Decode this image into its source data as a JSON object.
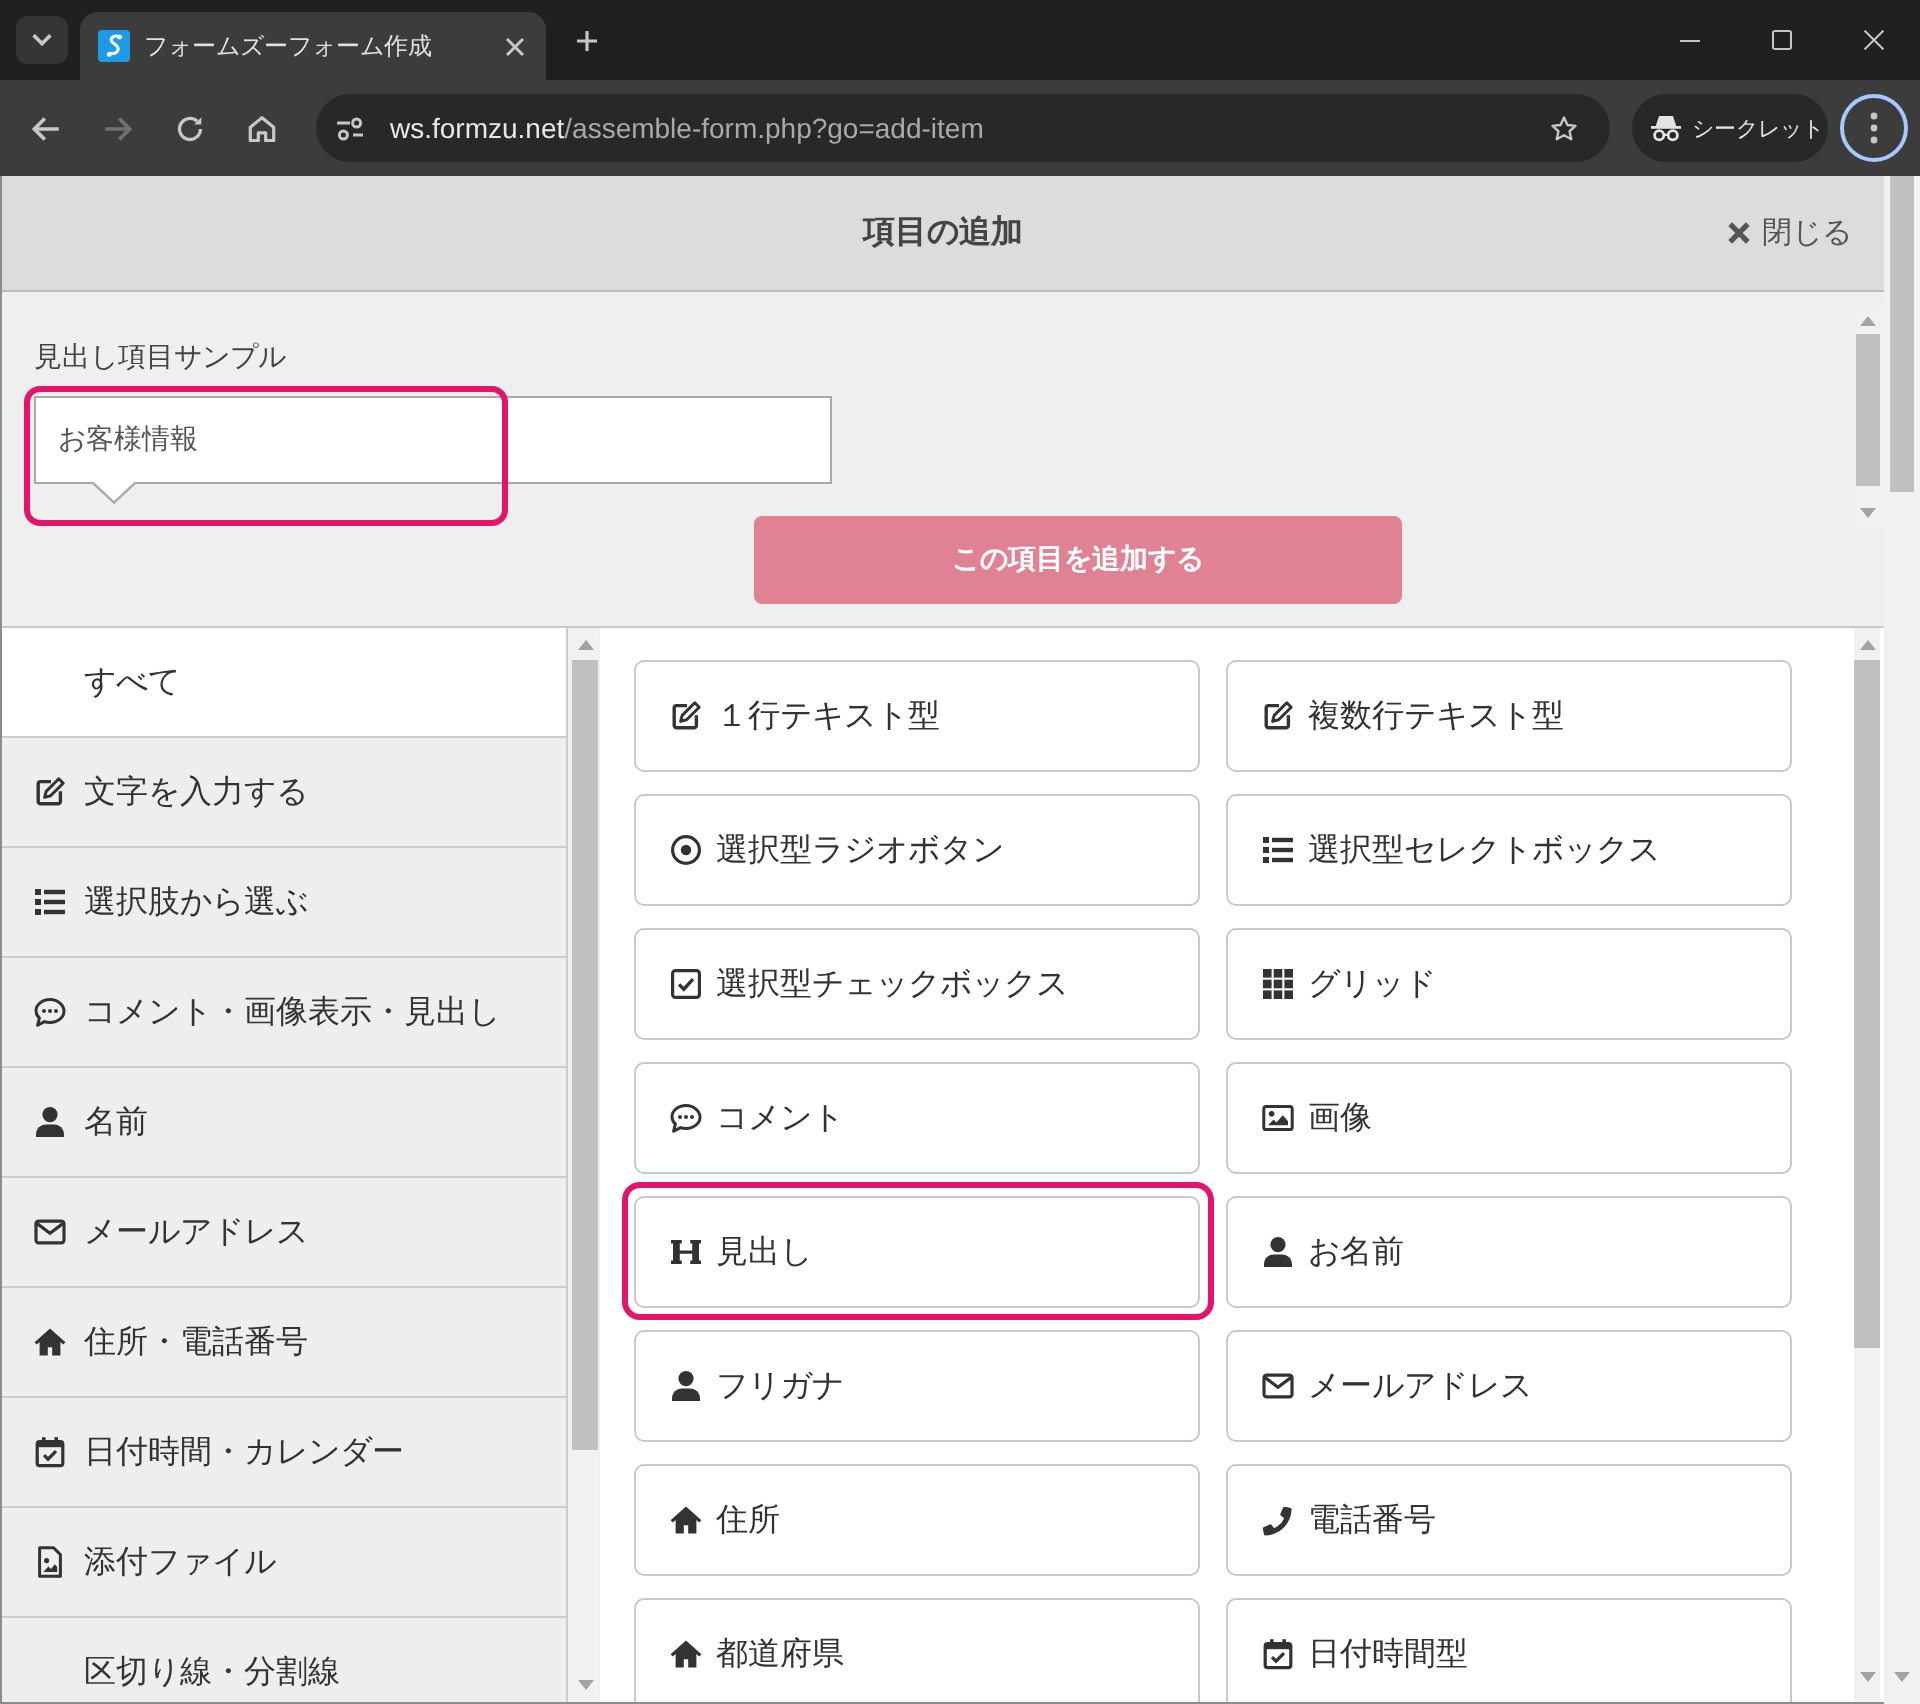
{
  "browser": {
    "tab": {
      "title": "フォームズーフォーム作成"
    },
    "forward_disabled": true,
    "address": {
      "host": "ws.formzu.net",
      "path": "/assemble-form.php?go=add-item"
    },
    "profile": {
      "label": "シークレット"
    }
  },
  "dialog": {
    "title": "項目の追加",
    "close_label": "閉じる"
  },
  "sample": {
    "label": "見出し項目サンプル",
    "value": "お客様情報",
    "highlighted": true,
    "add_button": "この項目を追加する"
  },
  "categories": [
    {
      "label": "すべて",
      "kind": "all",
      "selected": true
    },
    {
      "label": "文字を入力する",
      "kind": "text",
      "selected": false
    },
    {
      "label": "選択肢から選ぶ",
      "kind": "choice",
      "selected": false
    },
    {
      "label": "コメント・画像表示・見出し",
      "kind": "comment",
      "selected": false
    },
    {
      "label": "名前",
      "kind": "name",
      "selected": false
    },
    {
      "label": "メールアドレス",
      "kind": "email",
      "selected": false
    },
    {
      "label": "住所・電話番号",
      "kind": "address",
      "selected": false
    },
    {
      "label": "日付時間・カレンダー",
      "kind": "date",
      "selected": false
    },
    {
      "label": "添付ファイル",
      "kind": "file",
      "selected": false
    },
    {
      "label": "区切り線・分割線",
      "kind": "divider",
      "selected": false
    }
  ],
  "items": [
    {
      "label": "１行テキスト型",
      "kind": "text",
      "highlighted": false
    },
    {
      "label": "複数行テキスト型",
      "kind": "textarea",
      "highlighted": false
    },
    {
      "label": "選択型ラジオボタン",
      "kind": "radio",
      "highlighted": false
    },
    {
      "label": "選択型セレクトボックス",
      "kind": "select",
      "highlighted": false
    },
    {
      "label": "選択型チェックボックス",
      "kind": "checkbox",
      "highlighted": false
    },
    {
      "label": "グリッド",
      "kind": "grid",
      "highlighted": false
    },
    {
      "label": "コメント",
      "kind": "comment",
      "highlighted": false
    },
    {
      "label": "画像",
      "kind": "image",
      "highlighted": false
    },
    {
      "label": "見出し",
      "kind": "heading",
      "highlighted": true
    },
    {
      "label": "お名前",
      "kind": "name",
      "highlighted": false
    },
    {
      "label": "フリガナ",
      "kind": "furigana",
      "highlighted": false
    },
    {
      "label": "メールアドレス",
      "kind": "email",
      "highlighted": false
    },
    {
      "label": "住所",
      "kind": "address",
      "highlighted": false
    },
    {
      "label": "電話番号",
      "kind": "phone",
      "highlighted": false
    },
    {
      "label": "都道府県",
      "kind": "prefecture",
      "highlighted": false
    },
    {
      "label": "日付時間型",
      "kind": "datetime",
      "highlighted": false
    }
  ]
}
